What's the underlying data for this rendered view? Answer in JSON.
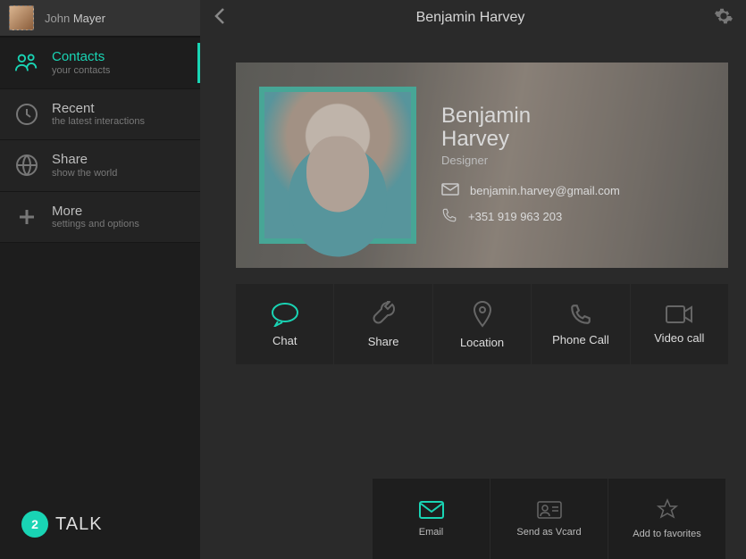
{
  "user": {
    "first": "John",
    "last": "Mayer"
  },
  "brand": {
    "badge": "2",
    "name": "TALK"
  },
  "sidebar": {
    "items": [
      {
        "label": "Contacts",
        "sub": "your contacts",
        "active": true
      },
      {
        "label": "Recent",
        "sub": "the latest interactions",
        "active": false
      },
      {
        "label": "Share",
        "sub": "show  the world",
        "active": false
      },
      {
        "label": "More",
        "sub": "settings and options",
        "active": false
      }
    ]
  },
  "header": {
    "title": "Benjamin Harvey"
  },
  "profile": {
    "name_line1": "Benjamin",
    "name_line2": "Harvey",
    "role": "Designer",
    "email": "benjamin.harvey@gmail.com",
    "phone": "+351 919 963 203"
  },
  "actions": [
    {
      "label": "Chat",
      "active": true
    },
    {
      "label": "Share",
      "active": false
    },
    {
      "label": "Location",
      "active": false
    },
    {
      "label": "Phone Call",
      "active": false
    },
    {
      "label": "Video call",
      "active": false
    }
  ],
  "bottom_actions": [
    {
      "label": "Email",
      "active": true
    },
    {
      "label": "Send as Vcard",
      "active": false
    },
    {
      "label": "Add to favorites",
      "active": false
    }
  ],
  "colors": {
    "accent": "#19d4b4"
  }
}
